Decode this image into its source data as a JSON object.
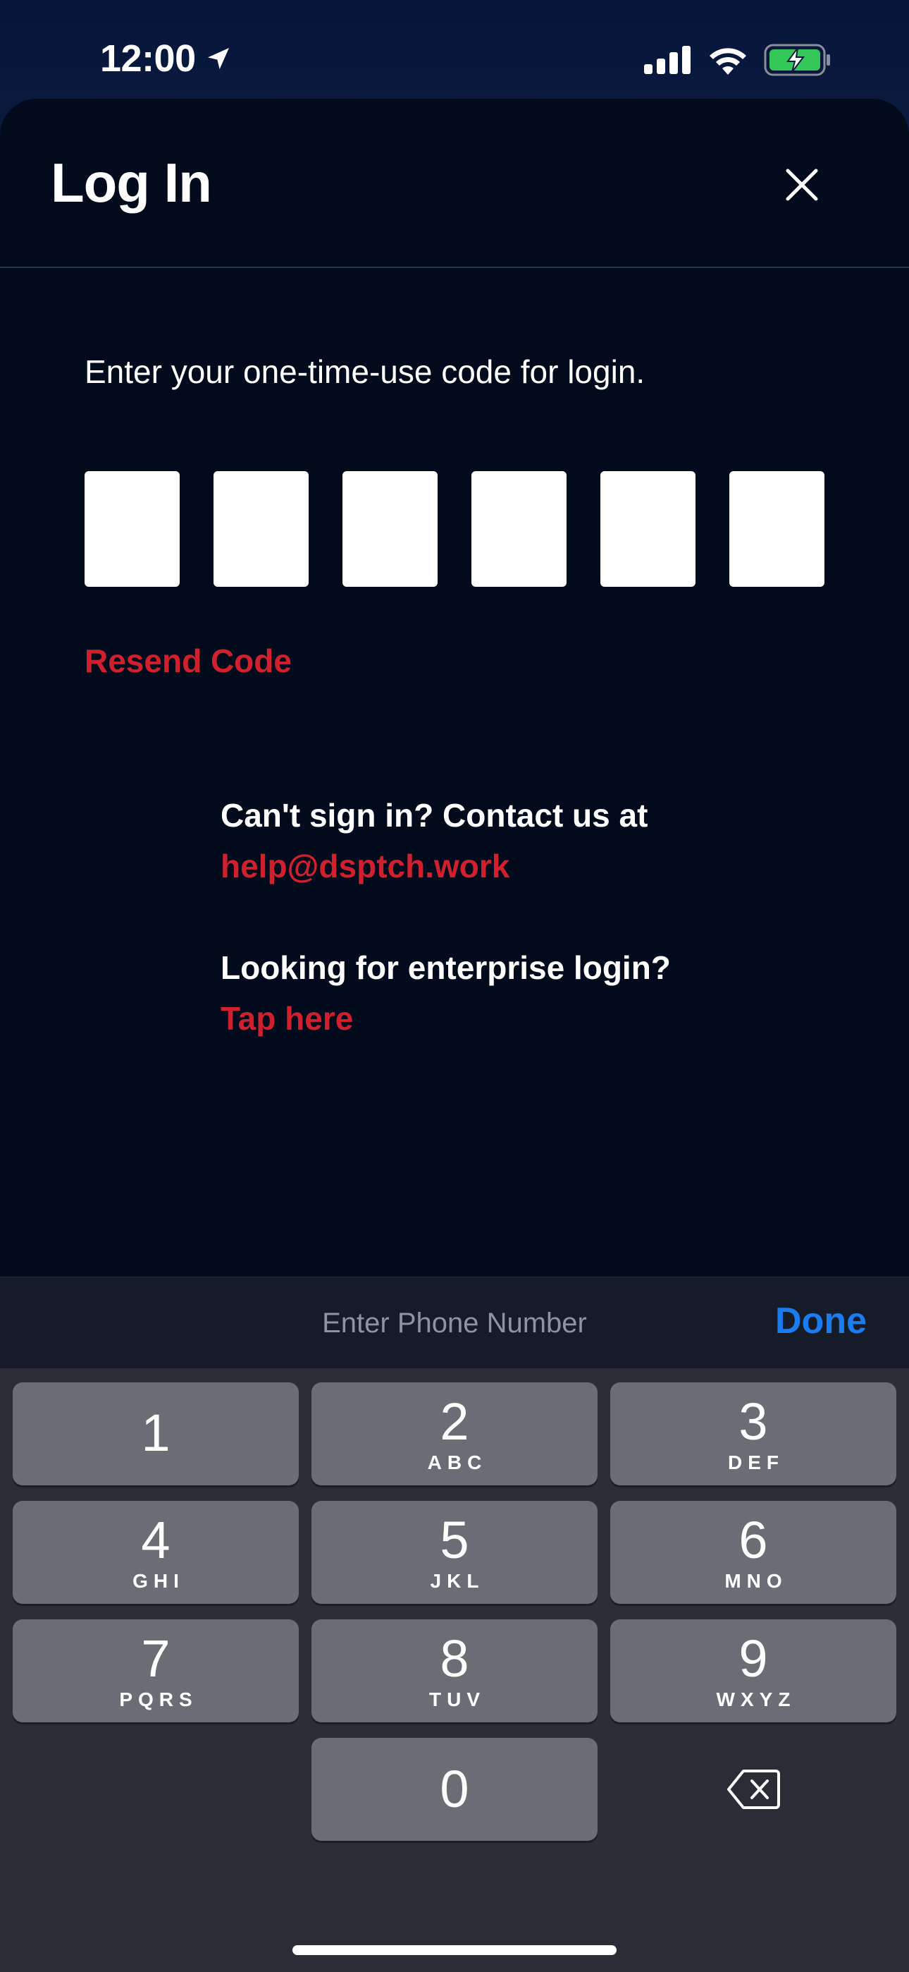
{
  "status_bar": {
    "time": "12:00"
  },
  "header": {
    "title": "Log In"
  },
  "main": {
    "prompt": "Enter your one-time-use code for login.",
    "code_boxes": [
      "",
      "",
      "",
      "",
      "",
      ""
    ],
    "resend_label": "Resend Code",
    "help": {
      "contact_text": "Can't sign in? Contact us at",
      "contact_email": "help@dsptch.work",
      "enterprise_text": "Looking for enterprise login?",
      "enterprise_link": "Tap here"
    }
  },
  "keyboard_accessory": {
    "placeholder": "Enter Phone Number",
    "done_label": "Done"
  },
  "keyboard": {
    "keys": [
      {
        "digit": "1",
        "letters": ""
      },
      {
        "digit": "2",
        "letters": "ABC"
      },
      {
        "digit": "3",
        "letters": "DEF"
      },
      {
        "digit": "4",
        "letters": "GHI"
      },
      {
        "digit": "5",
        "letters": "JKL"
      },
      {
        "digit": "6",
        "letters": "MNO"
      },
      {
        "digit": "7",
        "letters": "PQRS"
      },
      {
        "digit": "8",
        "letters": "TUV"
      },
      {
        "digit": "9",
        "letters": "WXYZ"
      },
      {
        "digit": "0",
        "letters": ""
      }
    ]
  },
  "colors": {
    "accent_red": "#d0202e",
    "done_blue": "#1b7cf0",
    "sheet_background": "#010b1c",
    "battery_green": "#34c759"
  }
}
